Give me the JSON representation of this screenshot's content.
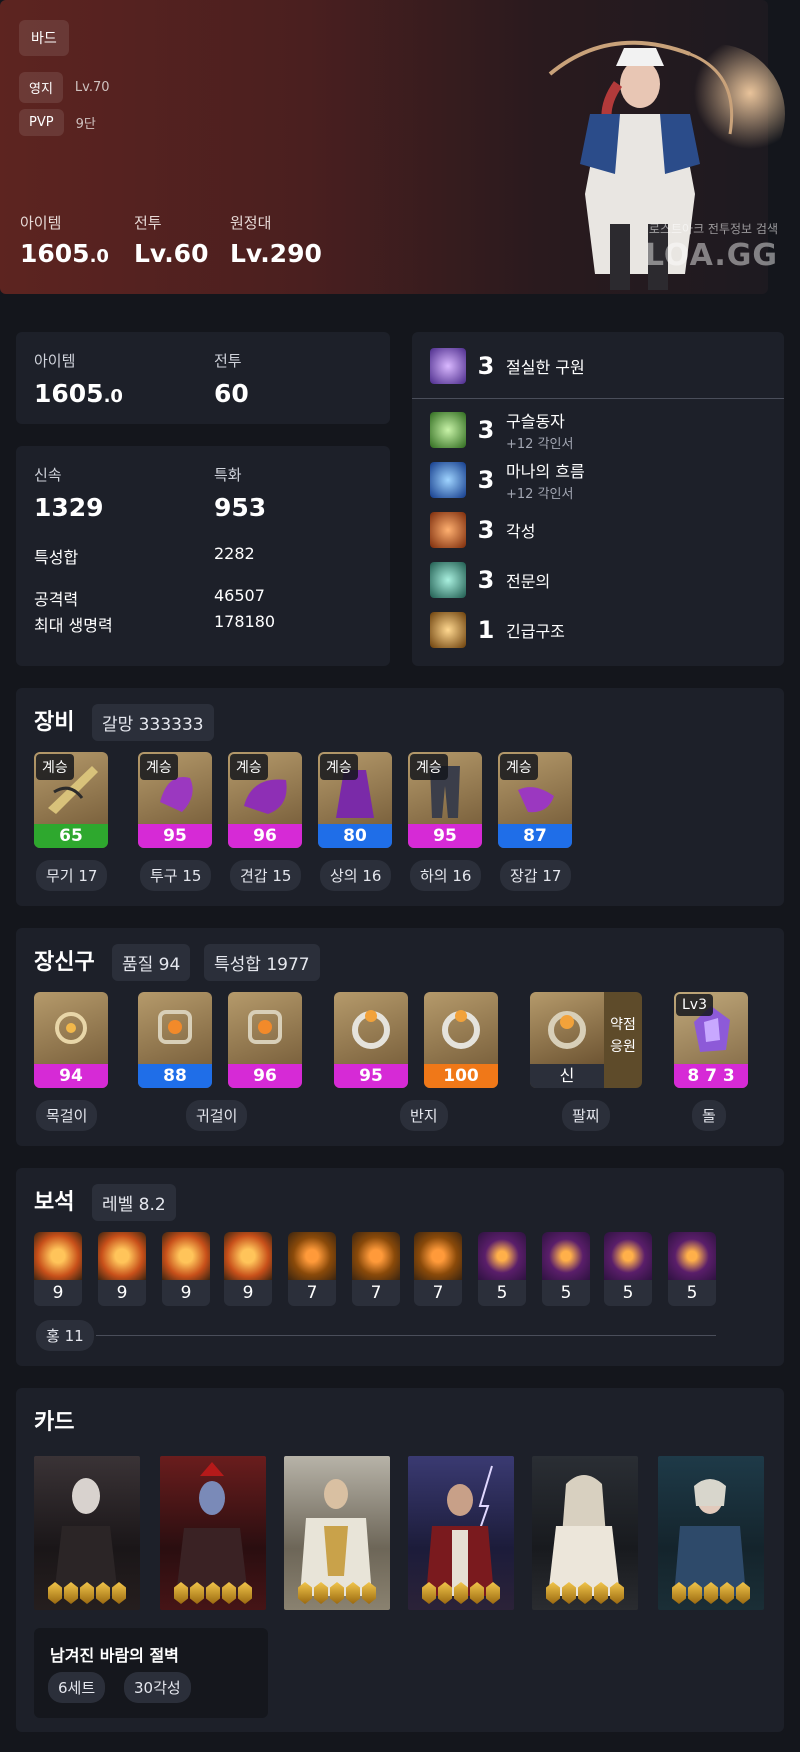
{
  "hero": {
    "class": "바드",
    "estate_label": "영지",
    "estate_value": "Lv.70",
    "pvp_label": "PVP",
    "pvp_value": "9단",
    "item_label": "아이템",
    "item_main": "1605",
    "item_dec": ".0",
    "combat_label": "전투",
    "combat_value": "Lv.60",
    "expedition_label": "원정대",
    "expedition_value": "Lv.290",
    "watermark_small": "로스트아크 전투정보 검색",
    "watermark_big": "LOA.GG"
  },
  "stats": {
    "item_label": "아이템",
    "item_main": "1605",
    "item_dec": ".0",
    "combat_label": "전투",
    "combat_value": "60",
    "swift_label": "신속",
    "swift_value": "1329",
    "spec_label": "특화",
    "spec_value": "953",
    "total_label": "특성합",
    "total_value": "2282",
    "atk_label": "공격력",
    "atk_value": "46507",
    "hp_label": "최대 생명력",
    "hp_value": "178180"
  },
  "engravings": [
    {
      "level": "3",
      "name": "절실한 구원",
      "sub": "",
      "icon": "desperate-salvation-icon",
      "color": "#7b4cc9"
    },
    {
      "level": "3",
      "name": "구슬동자",
      "sub": "+12 각인서",
      "icon": "drops-of-ether-icon",
      "color": "#4caa3a"
    },
    {
      "level": "3",
      "name": "마나의 흐름",
      "sub": "+12 각인서",
      "icon": "mana-flow-icon",
      "color": "#2b6fd8"
    },
    {
      "level": "3",
      "name": "각성",
      "sub": "",
      "icon": "awakening-icon",
      "color": "#c85a1e"
    },
    {
      "level": "3",
      "name": "전문의",
      "sub": "",
      "icon": "expert-icon",
      "color": "#2e8a78"
    },
    {
      "level": "1",
      "name": "긴급구조",
      "sub": "",
      "icon": "emergency-rescue-icon",
      "color": "#b07a22"
    }
  ],
  "equipment": {
    "title": "장비",
    "set": "갈망 333333",
    "items": [
      {
        "badge": "계승",
        "quality": "65",
        "label": "무기 17",
        "bar": "#2ea82e",
        "art": "#b69a5a"
      },
      {
        "badge": "계승",
        "quality": "95",
        "label": "투구 15",
        "bar": "#d62ad6",
        "art": "#b59a6b"
      },
      {
        "badge": "계승",
        "quality": "96",
        "label": "견갑 15",
        "bar": "#d62ad6",
        "art": "#a88a5d"
      },
      {
        "badge": "계승",
        "quality": "80",
        "label": "상의 16",
        "bar": "#1f6ee8",
        "art": "#b19566"
      },
      {
        "badge": "계승",
        "quality": "95",
        "label": "하의 16",
        "bar": "#d62ad6",
        "art": "#a98f63"
      },
      {
        "badge": "계승",
        "quality": "87",
        "label": "장갑 17",
        "bar": "#1f6ee8",
        "art": "#b59a6b"
      }
    ]
  },
  "accessories": {
    "title": "장신구",
    "quality": "품질 94",
    "total": "특성합 1977",
    "items": [
      {
        "quality": "94",
        "bar": "#d62ad6"
      },
      {
        "quality": "88",
        "bar": "#1f6ee8"
      },
      {
        "quality": "96",
        "bar": "#d62ad6"
      },
      {
        "quality": "95",
        "bar": "#d62ad6"
      },
      {
        "quality": "100",
        "bar": "#f07818"
      }
    ],
    "bracelet_label": "신",
    "bracelet_side": "약점\n응원",
    "stone_level": "Lv3",
    "stone_value": "8 7 3",
    "labels": [
      "목걸이",
      "귀걸이",
      "반지",
      "팔찌",
      "돌"
    ]
  },
  "gems": {
    "title": "보석",
    "level": "레벨 8.2",
    "items": [
      "9",
      "9",
      "9",
      "9",
      "7",
      "7",
      "7",
      "5",
      "5",
      "5",
      "5"
    ],
    "red_count": "홍 11"
  },
  "cards": {
    "title": "카드",
    "set_name": "남겨진 바람의 절벽",
    "set_count": "6세트",
    "set_awaken": "30각성"
  }
}
